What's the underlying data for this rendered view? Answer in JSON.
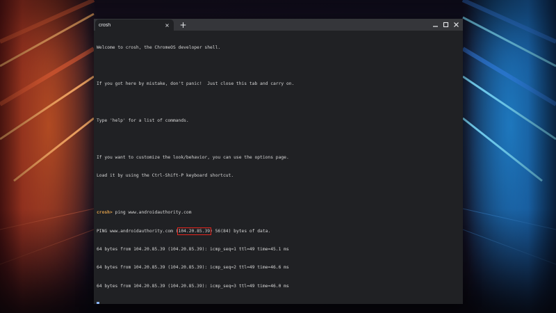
{
  "tab": {
    "title": "crosh",
    "close_glyph": "×",
    "new_tab_glyph": "+"
  },
  "window_controls": {
    "minimize_icon": "minimize-icon",
    "maximize_icon": "maximize-icon",
    "close_icon": "close-icon"
  },
  "terminal": {
    "welcome": "Welcome to crosh, the ChromeOS developer shell.",
    "mistake": "If you got here by mistake, don't panic!  Just close this tab and carry on.",
    "help": "Type 'help' for a list of commands.",
    "customize_1": "If you want to customize the look/behavior, you can use the options page.",
    "customize_2": "Load it by using the Ctrl-Shift-P keyboard shortcut.",
    "prompt": "crosh>",
    "command": " ping www.androidauthority.com",
    "ping_prefix": "PING www.androidauthority.com (",
    "ping_ip": "104.20.85.39",
    "ping_suffix": ") 56(84) bytes of data.",
    "replies": [
      "64 bytes from 104.20.85.39 (104.20.85.39): icmp_seq=1 ttl=49 time=45.1 ms",
      "64 bytes from 104.20.85.39 (104.20.85.39): icmp_seq=2 ttl=49 time=46.6 ms",
      "64 bytes from 104.20.85.39 (104.20.85.39): icmp_seq=3 ttl=49 time=46.0 ms"
    ]
  },
  "colors": {
    "terminal_bg": "#202124",
    "titlebar_bg": "#35363a",
    "prompt": "#e0a04a",
    "highlight_box": "#e3261f",
    "cursor": "#8ab4f8"
  }
}
